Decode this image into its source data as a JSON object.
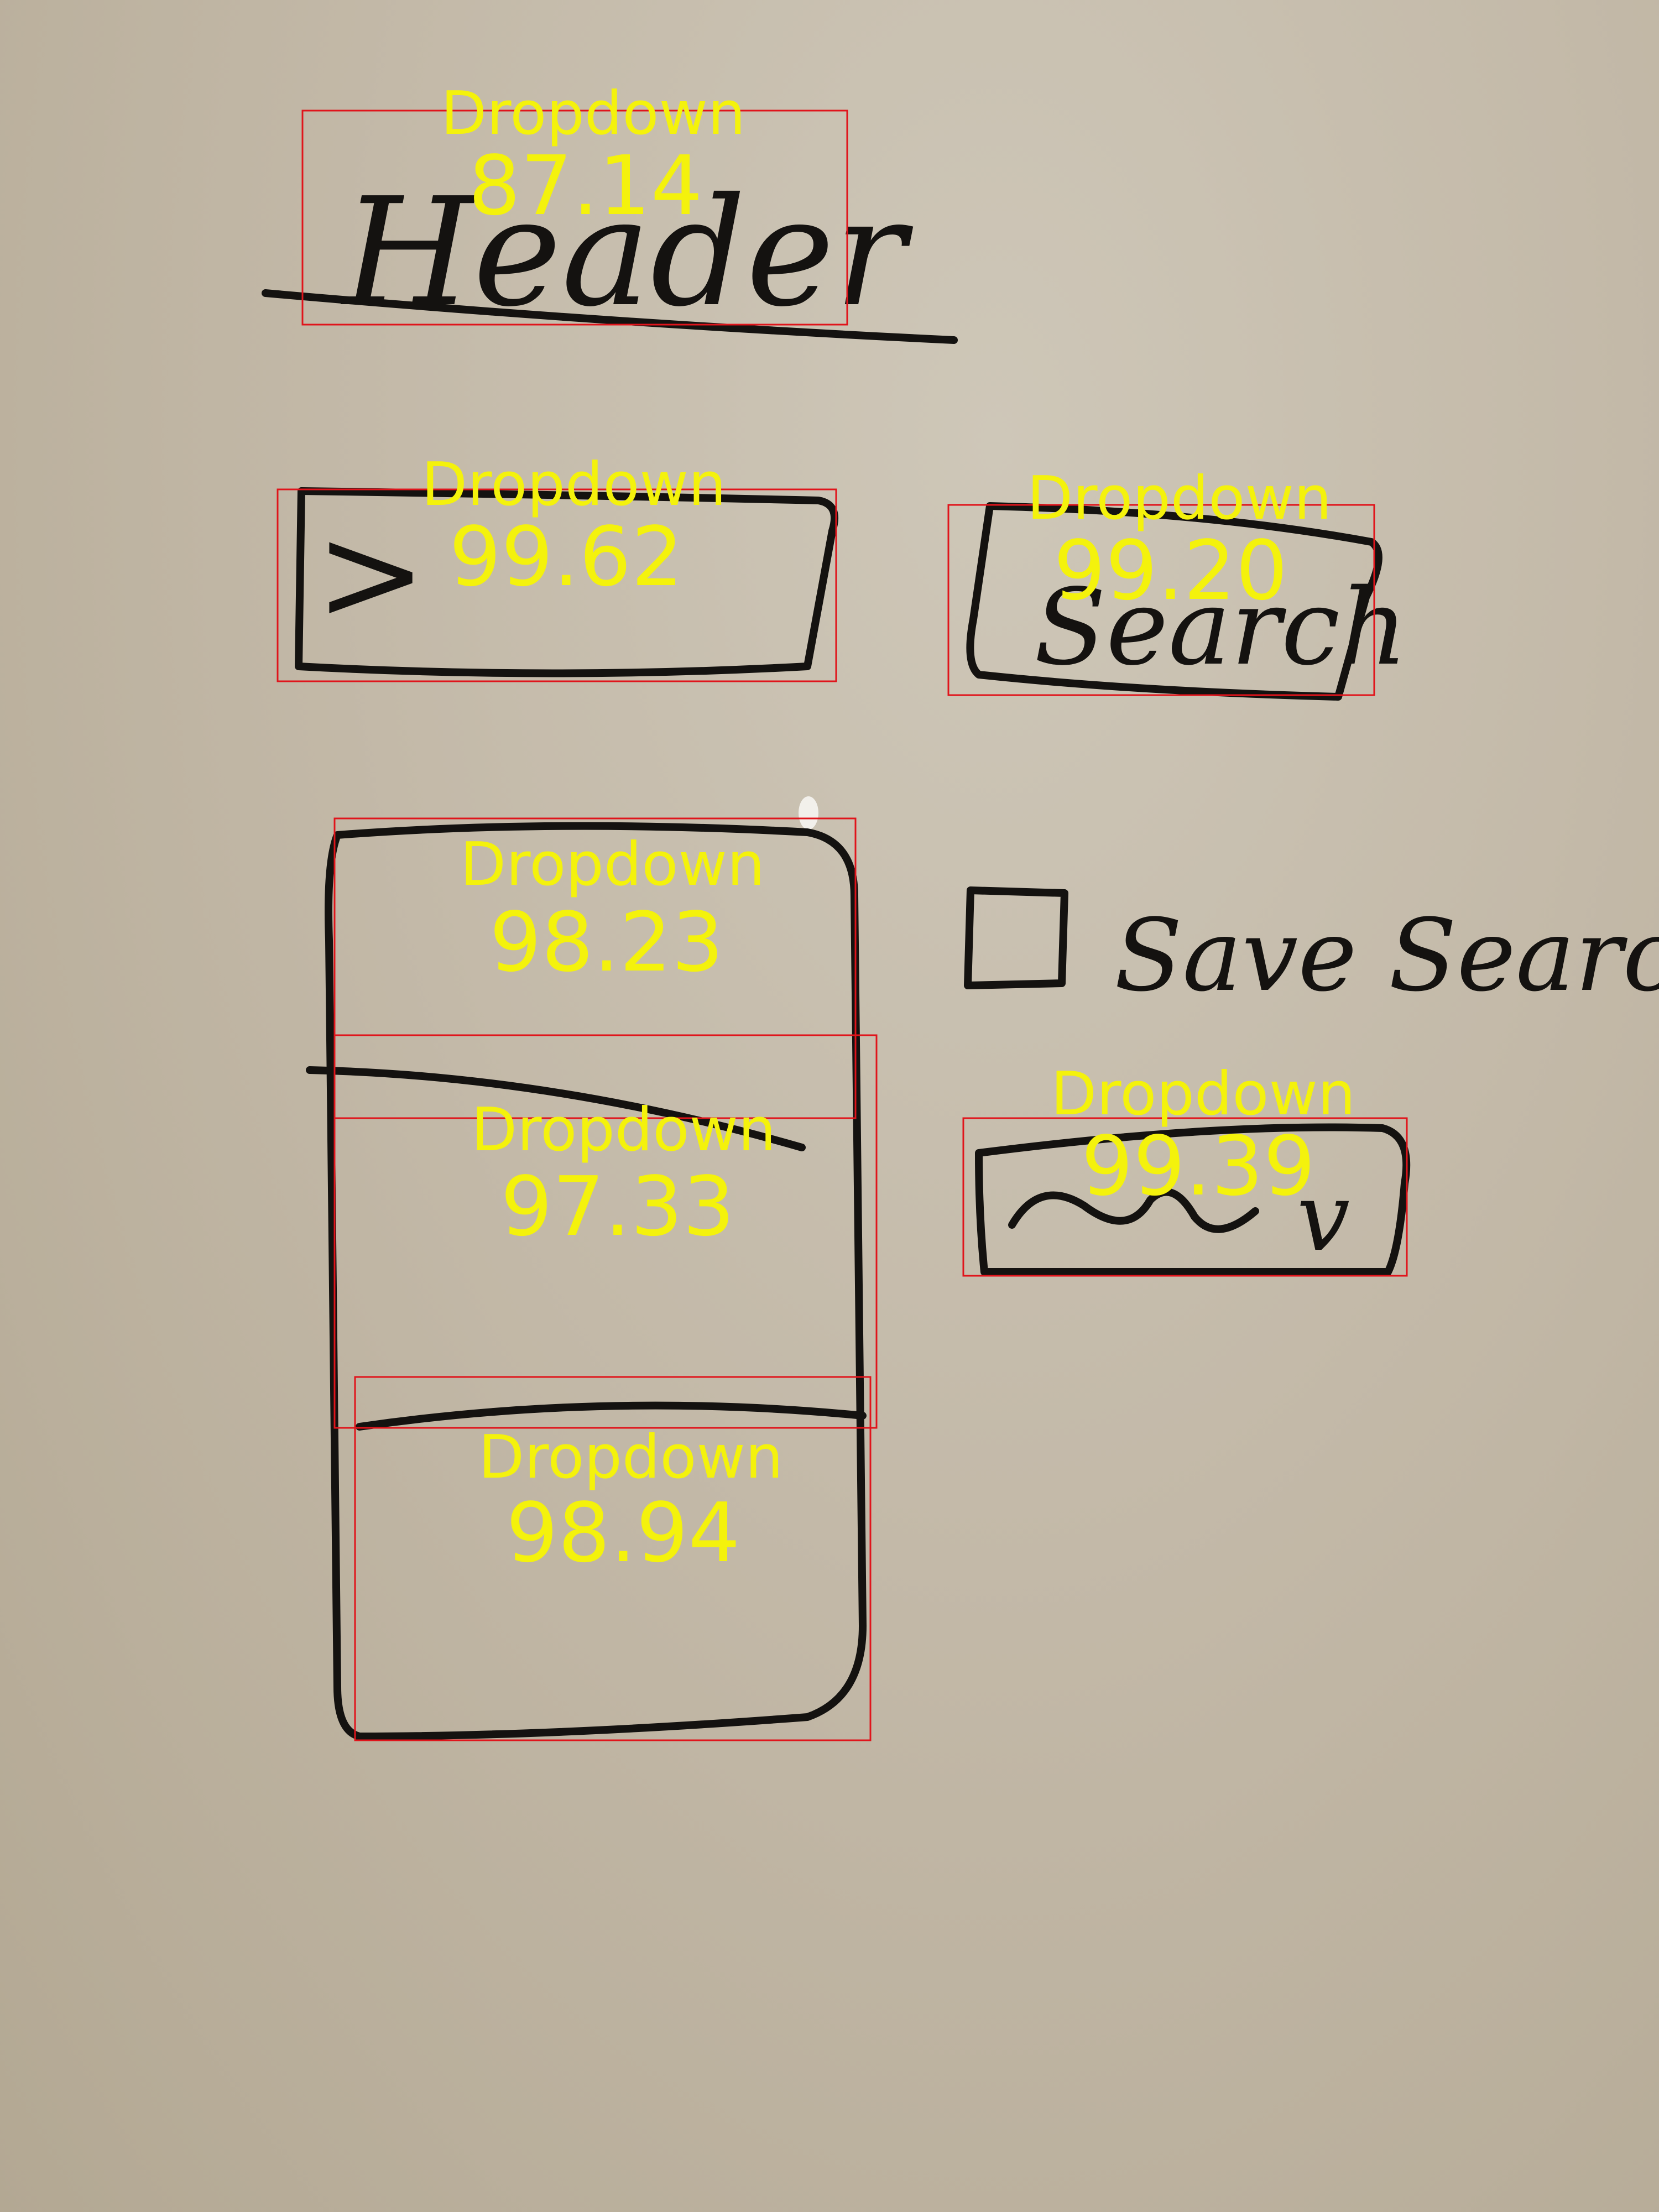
{
  "sketch": {
    "header_text": "Header",
    "search_text": "Search",
    "checkbox_text": "Save Search",
    "prompt_glyph": ">",
    "dropdown_chevron": "v"
  },
  "detections": [
    {
      "label": "Dropdown",
      "score": "87.14"
    },
    {
      "label": "Dropdown",
      "score": "99.62"
    },
    {
      "label": "Dropdown",
      "score": "99.20"
    },
    {
      "label": "Dropdown",
      "score": "98.23"
    },
    {
      "label": "Dropdown",
      "score": "97.33"
    },
    {
      "label": "Dropdown",
      "score": "99.39"
    },
    {
      "label": "Dropdown",
      "score": "98.94"
    }
  ],
  "colors": {
    "board": "#c3b9a8",
    "ink": "#141210",
    "box": "#e0141b",
    "label": "#f4f20c"
  }
}
